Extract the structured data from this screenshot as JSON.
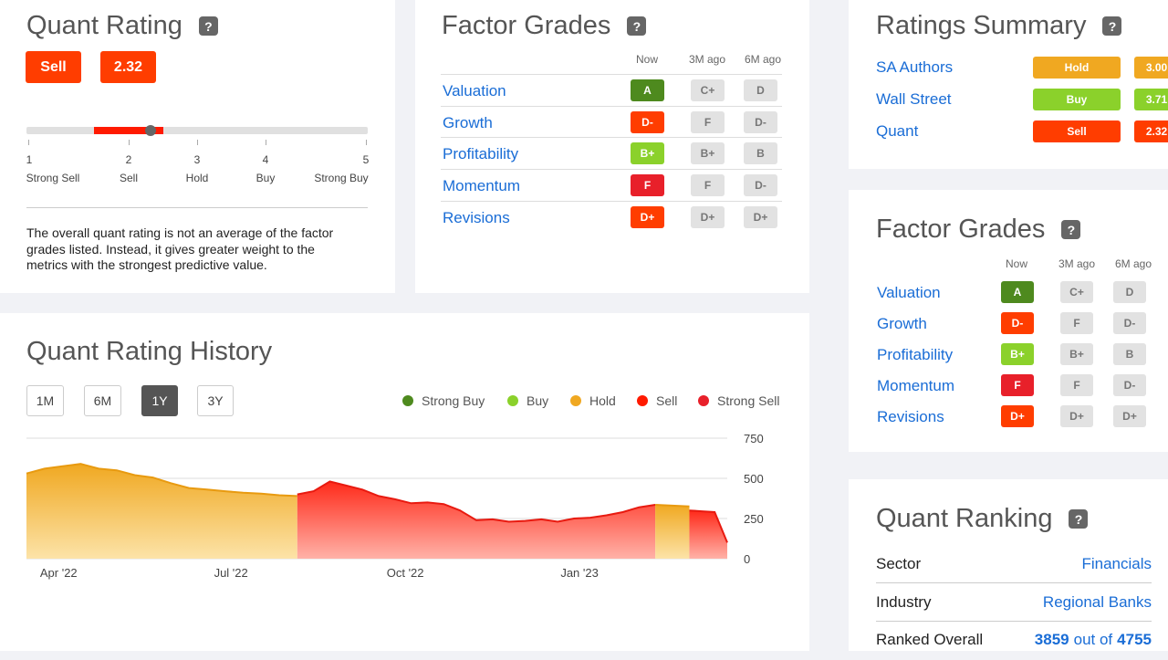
{
  "quant_rating": {
    "title": "Quant Rating",
    "help": "?",
    "rating_label": "Sell",
    "score": "2.32",
    "scale_numbers": [
      "1",
      "2",
      "3",
      "4",
      "5"
    ],
    "scale_labels": [
      "Strong Sell",
      "Sell",
      "Hold",
      "Buy",
      "Strong Buy"
    ],
    "slider_value": 2.32,
    "description": "The overall quant rating is not an average of the factor grades listed. Instead, it gives greater weight to the metrics with the strongest predictive value."
  },
  "factor_grades_main": {
    "title": "Factor Grades",
    "help": "?",
    "columns": [
      "Now",
      "3M ago",
      "6M ago"
    ],
    "rows": [
      {
        "label": "Valuation",
        "now": "A",
        "m3": "C+",
        "m6": "D"
      },
      {
        "label": "Growth",
        "now": "D-",
        "m3": "F",
        "m6": "D-"
      },
      {
        "label": "Profitability",
        "now": "B+",
        "m3": "B+",
        "m6": "B"
      },
      {
        "label": "Momentum",
        "now": "F",
        "m3": "F",
        "m6": "D-"
      },
      {
        "label": "Revisions",
        "now": "D+",
        "m3": "D+",
        "m6": "D+"
      }
    ]
  },
  "ratings_summary": {
    "title": "Ratings Summary",
    "help": "?",
    "rows": [
      {
        "label": "SA Authors",
        "rating": "Hold",
        "score": "3.00"
      },
      {
        "label": "Wall Street",
        "rating": "Buy",
        "score": "3.71"
      },
      {
        "label": "Quant",
        "rating": "Sell",
        "score": "2.32"
      }
    ]
  },
  "factor_grades_side": {
    "title": "Factor Grades",
    "help": "?",
    "columns": [
      "Now",
      "3M ago",
      "6M ago"
    ],
    "rows": [
      {
        "label": "Valuation",
        "now": "A",
        "m3": "C+",
        "m6": "D"
      },
      {
        "label": "Growth",
        "now": "D-",
        "m3": "F",
        "m6": "D-"
      },
      {
        "label": "Profitability",
        "now": "B+",
        "m3": "B+",
        "m6": "B"
      },
      {
        "label": "Momentum",
        "now": "F",
        "m3": "F",
        "m6": "D-"
      },
      {
        "label": "Revisions",
        "now": "D+",
        "m3": "D+",
        "m6": "D+"
      }
    ]
  },
  "quant_history": {
    "title": "Quant Rating History",
    "ranges": [
      "1M",
      "6M",
      "1Y",
      "3Y"
    ],
    "active_range": "1Y",
    "legend": [
      "Strong Buy",
      "Buy",
      "Hold",
      "Sell",
      "Strong Sell"
    ]
  },
  "quant_ranking": {
    "title": "Quant Ranking",
    "help": "?",
    "sector_label": "Sector",
    "sector_value": "Financials",
    "industry_label": "Industry",
    "industry_value": "Regional Banks",
    "overall_label": "Ranked Overall",
    "overall_rank": "3859",
    "overall_out_of": "out of",
    "overall_total": "4755"
  },
  "colors": {
    "strong_buy": "#4e8a1e",
    "buy": "#8bd12b",
    "hold": "#f0a821",
    "sell": "#ff3d00",
    "strong_sell": "#e8202a",
    "link": "#1a6dd6",
    "grade_A": "#4e8a1e",
    "grade_Bplus": "#8bd12b",
    "grade_F": "#e8202a",
    "grade_D": "#ff3d00"
  },
  "chart_data": {
    "type": "area",
    "x_ticks": [
      "Apr '22",
      "Jul '22",
      "Oct '22",
      "Jan '23"
    ],
    "y_ticks": [
      "750",
      "500",
      "250",
      "0"
    ],
    "ylim": [
      0,
      750
    ],
    "series": [
      {
        "name": "Hold",
        "color": "#f0a821",
        "x_range": [
          "2022-03-15",
          "2022-08-05"
        ],
        "values": [
          530,
          560,
          575,
          590,
          560,
          550,
          520,
          505,
          470,
          440,
          430,
          420,
          410,
          405,
          395,
          390
        ]
      },
      {
        "name": "Sell",
        "color": "#ff3d00",
        "x_range": [
          "2022-08-05",
          "2023-02-10"
        ],
        "values": [
          400,
          420,
          480,
          455,
          430,
          390,
          370,
          345,
          350,
          340,
          300,
          240,
          245,
          230,
          235,
          245,
          230,
          250,
          255,
          270,
          290,
          320,
          335
        ]
      },
      {
        "name": "Hold",
        "color": "#f0a821",
        "x_range": [
          "2023-02-10",
          "2023-02-28"
        ],
        "values": [
          335,
          330,
          325
        ]
      },
      {
        "name": "Sell",
        "color": "#ff3d00",
        "x_range": [
          "2023-02-28",
          "2023-03-20"
        ],
        "values": [
          300,
          295,
          290,
          100
        ]
      }
    ]
  }
}
